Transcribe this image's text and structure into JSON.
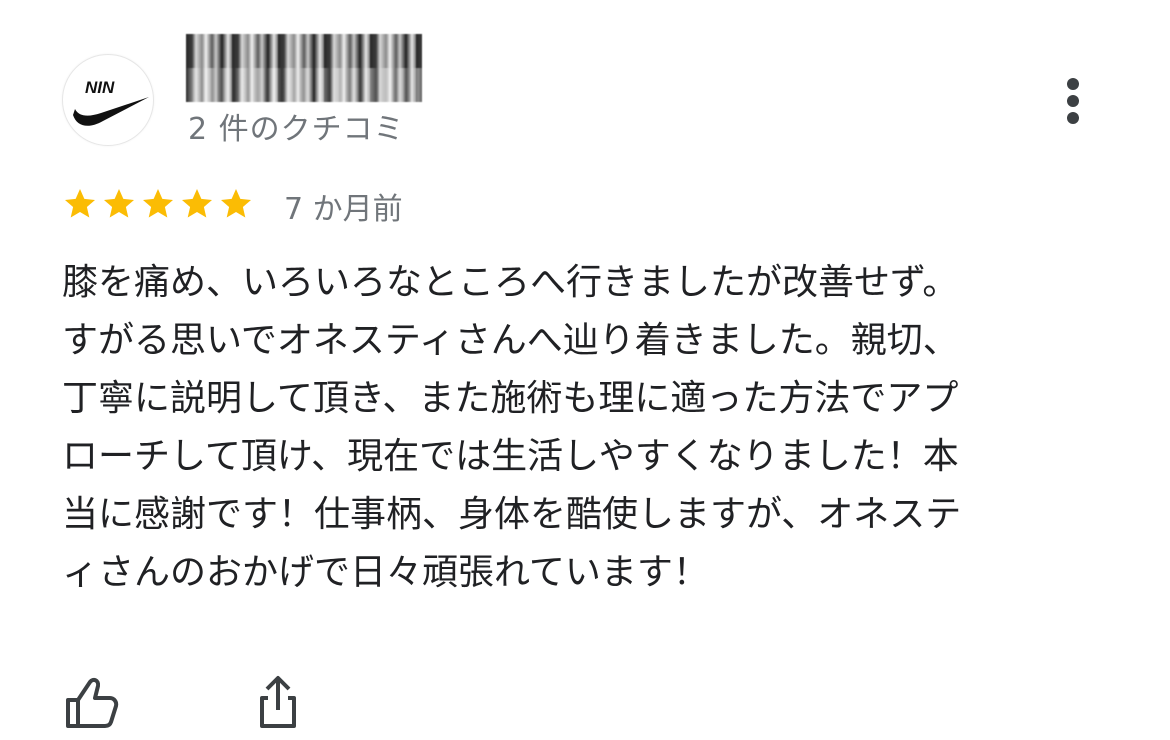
{
  "reviewer": {
    "avatar_logo_text": "NIN",
    "review_count": "2 件のクチコミ"
  },
  "rating": {
    "stars": 5,
    "max": 5,
    "star_color": "#fbbc04"
  },
  "time_ago": "7 か月前",
  "review_lines": [
    "膝を痛め、いろいろなところへ行きましたが改善せず。",
    "すがる思いでオネスティさんへ辿り着きました。親切、",
    "丁寧に説明して頂き、また施術も理に適った方法でアプ",
    "ローチして頂け、現在では生活しやすくなりました！本",
    "当に感謝です！仕事柄、身体を酷使しますが、オネステ",
    "ィさんのおかげで日々頑張れています！"
  ],
  "icons": {
    "menu": "more-vert-icon",
    "like": "thumb-up-icon",
    "share": "share-icon"
  },
  "colors": {
    "text": "#202124",
    "secondary": "#70757a",
    "star": "#fbbc04"
  }
}
